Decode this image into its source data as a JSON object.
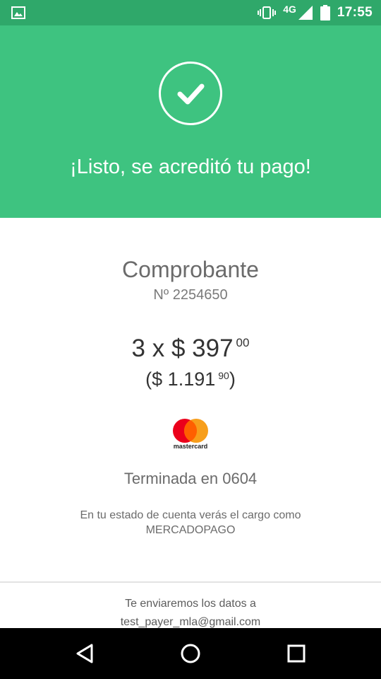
{
  "status_bar": {
    "network": "4G",
    "time": "17:55",
    "icons": [
      "image-icon",
      "vibrate-icon",
      "signal-icon",
      "battery-icon"
    ]
  },
  "header": {
    "icon": "check-icon",
    "title": "¡Listo, se acreditó tu pago!",
    "color": "#3ec380",
    "status_bar_color": "#2fa86a"
  },
  "receipt": {
    "title": "Comprobante",
    "number": "Nº 2254650",
    "installments_prefix": "3 x $ 397",
    "installments_cents": "00",
    "total_prefix": "($ 1.191",
    "total_cents": "90",
    "total_suffix": ")",
    "card_brand": "mastercard",
    "card_last4": "Terminada en 0604",
    "statement_note": "En tu estado de cuenta verás el cargo como MERCADOPAGO"
  },
  "footer": {
    "email_note_line1": "Te enviaremos los datos a",
    "email": "test_payer_mla@gmail.com"
  },
  "nav_bar": {
    "icons": [
      "back-icon",
      "home-icon",
      "recents-icon"
    ]
  }
}
